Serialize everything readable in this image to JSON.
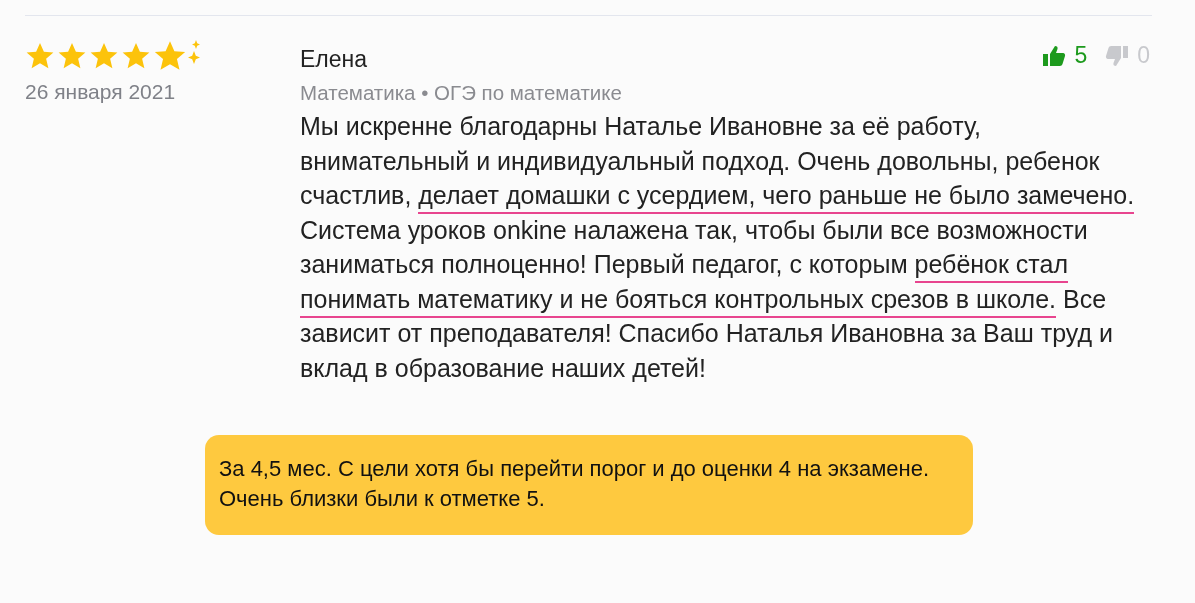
{
  "review": {
    "stars": 5,
    "date": "26 января 2021",
    "author": "Елена",
    "subject": "Математика • ОГЭ по математике",
    "likes": "5",
    "dislikes": "0",
    "text": [
      {
        "text": "Мы искренне благодарны Наталье Ивановне за её работу, внимательный и индивидуальный подход. Очень довольны, ребенок счастлив, ",
        "highlighted": false
      },
      {
        "text": "делает домашки с усердием, чего раньше не было замечено.",
        "highlighted": true
      },
      {
        "text": " Система уроков onkine налажена так, чтобы были все возможности заниматься полноценно! Первый педагог, с которым ",
        "highlighted": false
      },
      {
        "text": "ребёнок стал понимать математику и не бояться контрольных срезов в школе.",
        "highlighted": true
      },
      {
        "text": " Все зависит от преподавателя! Спасибо Наталья Ивановна за Ваш труд и вклад в образование наших детей!",
        "highlighted": false
      }
    ]
  },
  "callout": {
    "lines": [
      "За 4,5 мес. С цели хотя бы перейти порог и до оценки 4 на экзамене.",
      "Очень близки были к отметке 5."
    ]
  }
}
